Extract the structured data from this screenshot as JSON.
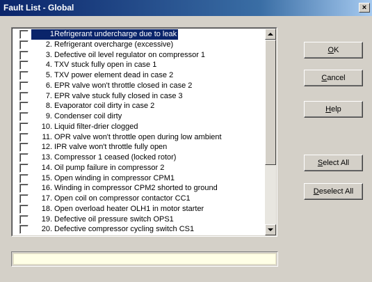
{
  "window": {
    "title": "Fault List - Global",
    "close_label": "×"
  },
  "faults": [
    {
      "num": "1.",
      "label": "Refrigerant undercharge due to leak",
      "selected": true
    },
    {
      "num": "2.",
      "label": "Refrigerant overcharge (excessive)"
    },
    {
      "num": "3.",
      "label": "Defective oil level regulator on compressor 1"
    },
    {
      "num": "4.",
      "label": "TXV stuck fully open in case 1"
    },
    {
      "num": "5.",
      "label": "TXV power element dead in case 2"
    },
    {
      "num": "6.",
      "label": "EPR valve won't throttle closed in case 2"
    },
    {
      "num": "7.",
      "label": "EPR valve stuck fully closed in case 3"
    },
    {
      "num": "8.",
      "label": "Evaporator coil dirty in case 2"
    },
    {
      "num": "9.",
      "label": "Condenser coil dirty"
    },
    {
      "num": "10.",
      "label": "Liquid filter-drier clogged"
    },
    {
      "num": "11.",
      "label": "OPR valve won't throttle open during low ambient"
    },
    {
      "num": "12.",
      "label": "IPR valve won't throttle fully open"
    },
    {
      "num": "13.",
      "label": "Compressor 1 ceased (locked rotor)"
    },
    {
      "num": "14.",
      "label": "Oil pump failure in compressor 2"
    },
    {
      "num": "15.",
      "label": "Open winding in compressor CPM1"
    },
    {
      "num": "16.",
      "label": "Winding in compressor CPM2 shorted to ground"
    },
    {
      "num": "17.",
      "label": "Open coil on compressor contactor CC1"
    },
    {
      "num": "18.",
      "label": "Open overload heater OLH1 in motor starter"
    },
    {
      "num": "19.",
      "label": "Defective oil pressure switch OPS1"
    },
    {
      "num": "20.",
      "label": "Defective compressor cycling switch CS1"
    }
  ],
  "buttons": {
    "ok": {
      "mnemonic": "O",
      "rest": "K"
    },
    "cancel": {
      "mnemonic": "C",
      "rest": "ancel"
    },
    "help": {
      "mnemonic": "H",
      "rest": "elp"
    },
    "select_all": {
      "mnemonic": "S",
      "rest": "elect All"
    },
    "deselect_all": {
      "mnemonic": "D",
      "rest": "eselect All"
    }
  },
  "status_text": "",
  "colors": {
    "title_start": "#0a246a",
    "title_end": "#a6caf0",
    "selection": "#0a246a",
    "status_bg": "#ffffe6"
  }
}
